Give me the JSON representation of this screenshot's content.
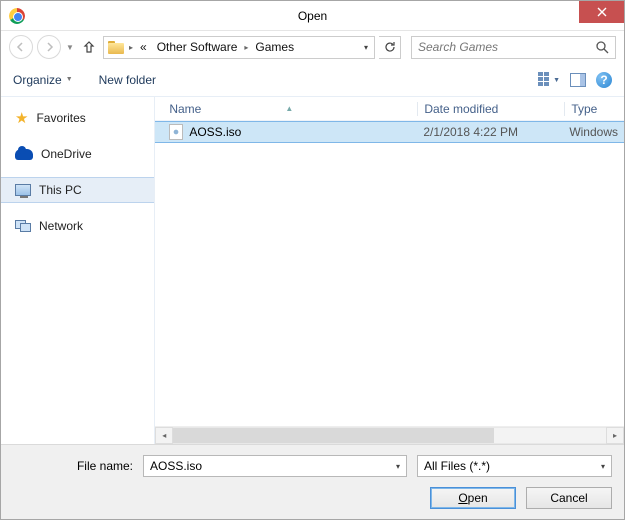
{
  "title": "Open",
  "breadcrumb": {
    "prefix": "«",
    "part1": "Other Software",
    "part2": "Games"
  },
  "search": {
    "placeholder": "Search Games"
  },
  "toolbar": {
    "organize": "Organize",
    "newfolder": "New folder"
  },
  "sidebar": {
    "favorites": "Favorites",
    "onedrive": "OneDrive",
    "thispc": "This PC",
    "network": "Network"
  },
  "columns": {
    "name": "Name",
    "date": "Date modified",
    "type": "Type"
  },
  "file": {
    "name": "AOSS.iso",
    "date": "2/1/2018 4:22 PM",
    "type": "Windows"
  },
  "footer": {
    "filename_label": "File name:",
    "filename_value": "AOSS.iso",
    "filter": "All Files (*.*)",
    "open_u": "O",
    "open_rest": "pen",
    "cancel": "Cancel"
  }
}
